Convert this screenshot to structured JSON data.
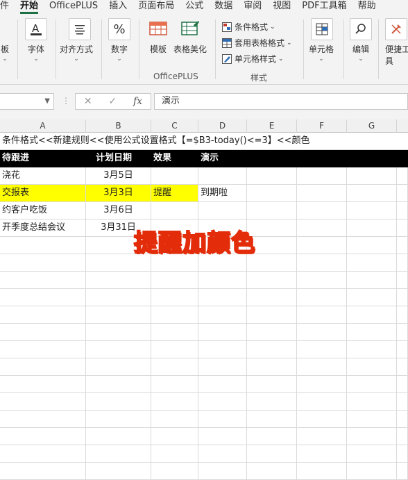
{
  "menu": {
    "tabs": [
      "件",
      "开始",
      "OfficePLUS",
      "插入",
      "页面布局",
      "公式",
      "数据",
      "审阅",
      "视图",
      "PDF工具箱",
      "帮助"
    ],
    "active_index": 1
  },
  "ribbon": {
    "paste_partial": "板",
    "font": "字体",
    "alignment": "对齐方式",
    "number": "数字",
    "template": "模板",
    "table_beautify": "表格美化",
    "officeplus_group": "OfficePLUS",
    "conditional_format": "条件格式",
    "table_format": "套用表格格式",
    "cell_style": "单元格样式",
    "styles_group": "样式",
    "cells": "单元格",
    "editing": "编辑",
    "convenient_tools": "便捷工",
    "convenient_tools_line2": "具"
  },
  "formula_bar": {
    "fx": "fx",
    "content": "演示"
  },
  "columns": [
    "A",
    "B",
    "C",
    "D",
    "E",
    "F",
    "G"
  ],
  "sheet": {
    "note_row": "条件格式<<新建规则<<使用公式设置格式【=$B3-today()<=3】<<颜色",
    "header": {
      "a": "待跟进",
      "b": "计划日期",
      "c": "效果",
      "d": "演示"
    },
    "rows": [
      {
        "a": "浇花",
        "b": "3月5日",
        "c": "",
        "d": ""
      },
      {
        "a": "交报表",
        "b": "3月3日",
        "c": "提醒",
        "d": "到期啦"
      },
      {
        "a": "约客户吃饭",
        "b": "3月6日",
        "c": "",
        "d": ""
      },
      {
        "a": "开季度总结会议",
        "b": "3月31日",
        "c": "",
        "d": ""
      }
    ]
  },
  "overlay_caption": "提醒加颜色",
  "colors": {
    "highlight": "#ffff00",
    "header_bg": "#000000",
    "caption_fill": "#ffe100",
    "caption_stroke": "#e32d0a"
  }
}
